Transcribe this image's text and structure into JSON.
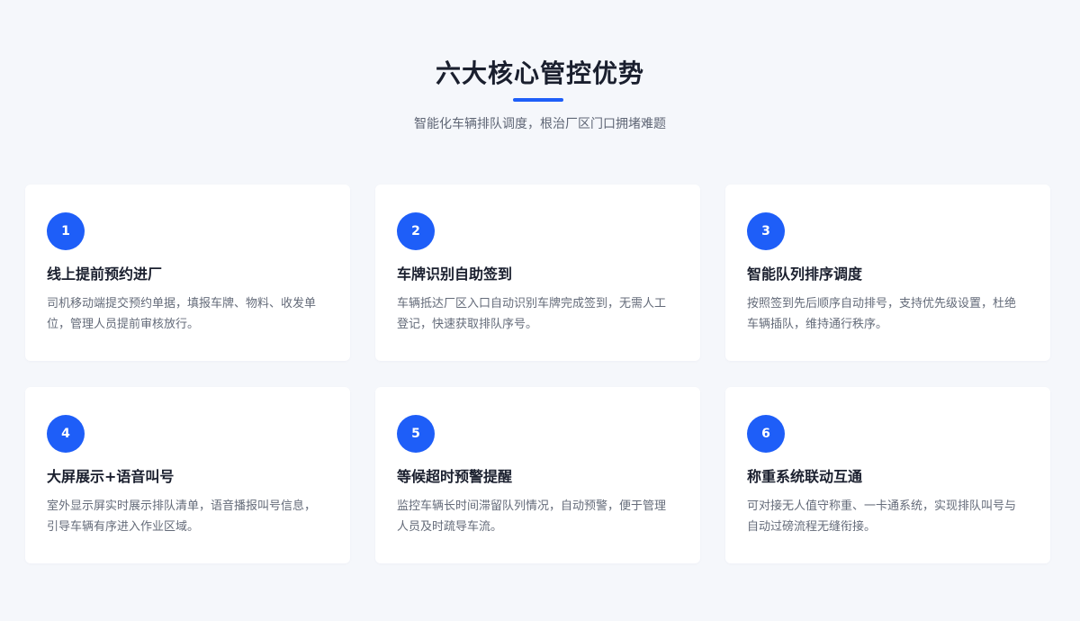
{
  "header": {
    "title": "六大核心管控优势",
    "subtitle": "智能化车辆排队调度，根治厂区门口拥堵难题"
  },
  "colors": {
    "accent": "#1e5ef8",
    "background": "#f5f7fb",
    "card": "#ffffff"
  },
  "features": [
    {
      "number": "1",
      "title": "线上提前预约进厂",
      "description": "司机移动端提交预约单据，填报车牌、物料、收发单位，管理人员提前审核放行。"
    },
    {
      "number": "2",
      "title": "车牌识别自助签到",
      "description": "车辆抵达厂区入口自动识别车牌完成签到，无需人工登记，快速获取排队序号。"
    },
    {
      "number": "3",
      "title": "智能队列排序调度",
      "description": "按照签到先后顺序自动排号，支持优先级设置，杜绝车辆插队，维持通行秩序。"
    },
    {
      "number": "4",
      "title": "大屏展示+语音叫号",
      "description": "室外显示屏实时展示排队清单，语音播报叫号信息，引导车辆有序进入作业区域。"
    },
    {
      "number": "5",
      "title": "等候超时预警提醒",
      "description": "监控车辆长时间滞留队列情况，自动预警，便于管理人员及时疏导车流。"
    },
    {
      "number": "6",
      "title": "称重系统联动互通",
      "description": "可对接无人值守称重、一卡通系统，实现排队叫号与自动过磅流程无缝衔接。"
    }
  ]
}
